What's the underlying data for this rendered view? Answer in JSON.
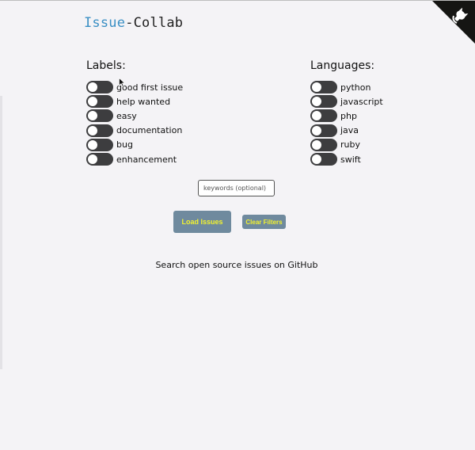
{
  "brand": {
    "part1": "Issue",
    "part2": "-Collab"
  },
  "colors": {
    "brand_accent": "#3a8fc4",
    "button_bg": "#6f8a9e",
    "button_text": "#f2f230",
    "toggle_off": "#3d3d3f",
    "page_bg": "#f4f3f6"
  },
  "corner": {
    "icon": "github-octocat-icon"
  },
  "labels": {
    "title": "Labels:",
    "items": [
      {
        "label": "good first issue",
        "on": false
      },
      {
        "label": "help wanted",
        "on": false
      },
      {
        "label": "easy",
        "on": false
      },
      {
        "label": "documentation",
        "on": false
      },
      {
        "label": "bug",
        "on": false
      },
      {
        "label": "enhancement",
        "on": false
      }
    ]
  },
  "languages": {
    "title": "Languages:",
    "items": [
      {
        "label": "python",
        "on": false
      },
      {
        "label": "javascript",
        "on": false
      },
      {
        "label": "php",
        "on": false
      },
      {
        "label": "java",
        "on": false
      },
      {
        "label": "ruby",
        "on": false
      },
      {
        "label": "swift",
        "on": false
      }
    ]
  },
  "search": {
    "placeholder": "keywords (optional)",
    "value": ""
  },
  "buttons": {
    "load": "Load Issues",
    "clear": "Clear Filters"
  },
  "tagline": "Search open source issues on GitHub"
}
